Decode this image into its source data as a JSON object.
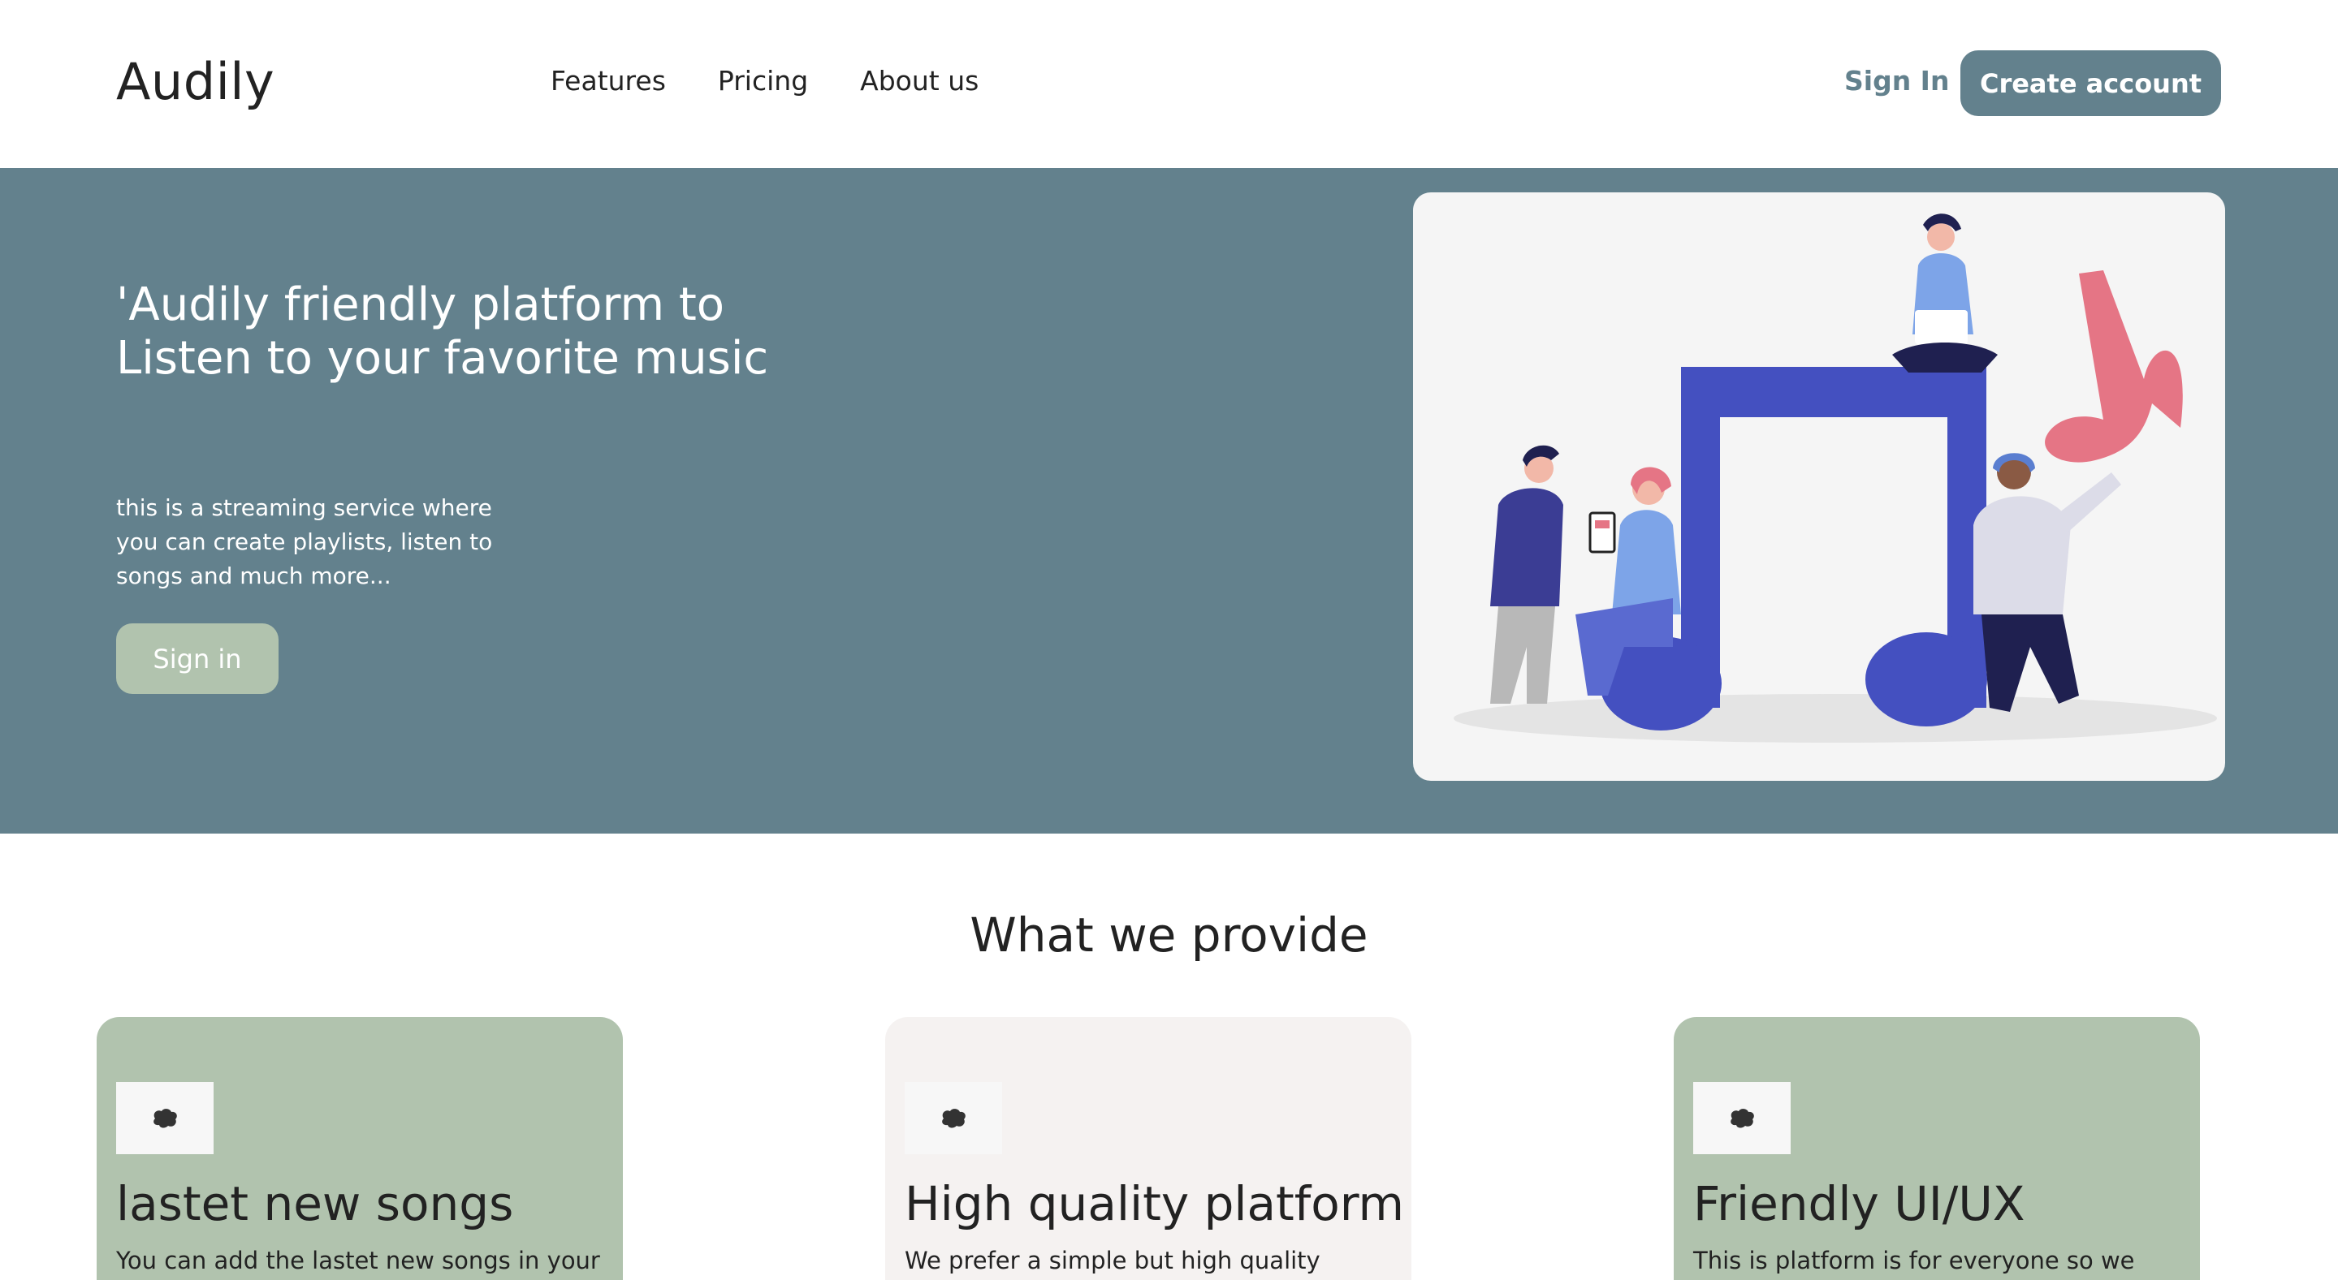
{
  "nav": {
    "brand": "Audily",
    "links": [
      "Features",
      "Pricing",
      "About us"
    ],
    "sign_in": "Sign In",
    "create_account": "Create account"
  },
  "hero": {
    "title": "'Audily friendly platform to Listen to your favorite music",
    "description": "this is a streaming service where you can create playlists, listen to songs and much more...",
    "button": "Sign in"
  },
  "features": {
    "title": "What we provide",
    "cards": [
      {
        "icon": "brain-icon",
        "title": "lastet new songs",
        "text": "You can add the lastet new songs in your"
      },
      {
        "icon": "brain-icon",
        "title": "High quality platform",
        "text": "We prefer a simple but high quality"
      },
      {
        "icon": "brain-icon",
        "title": "Friendly UI/UX",
        "text": "This is platform is for everyone so we"
      }
    ]
  },
  "colors": {
    "primary": "#63818d",
    "accent_green": "#b1c3ae",
    "card_light": "#f5f2f1",
    "note_blue": "#4450c0",
    "note_pink": "#e57585"
  }
}
